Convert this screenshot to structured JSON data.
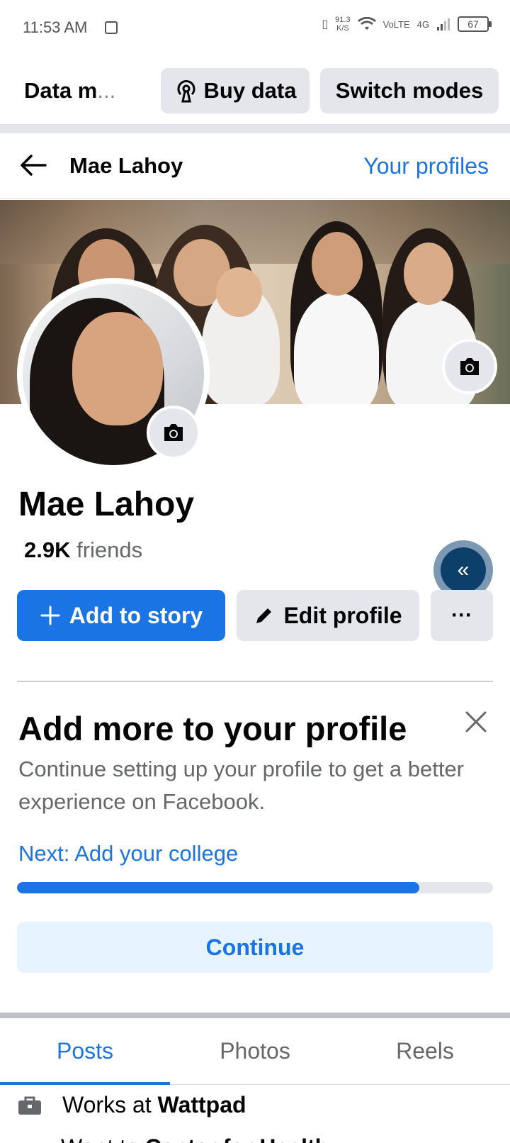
{
  "status": {
    "time": "11:53 AM",
    "speed_value": "91.3",
    "speed_unit": "K/S",
    "network": "4G",
    "battery": "67"
  },
  "data_bar": {
    "label": "Data m",
    "ellipsis": "...",
    "buy_label": "Buy data",
    "switch_label": "Switch modes"
  },
  "header": {
    "title": "Mae Lahoy",
    "link": "Your profiles"
  },
  "profile": {
    "name": "Mae Lahoy",
    "friends_count": "2.9K",
    "friends_label": "friends"
  },
  "actions": {
    "add_story": "Add to story",
    "edit_profile": "Edit profile",
    "more": "···"
  },
  "card": {
    "title": "Add more to your profile",
    "description": "Continue setting up your profile to get a better experience on Facebook.",
    "next": "Next: Add your college",
    "progress": 0.845,
    "continue_label": "Continue"
  },
  "tabs": [
    {
      "label": "Posts",
      "active": true
    },
    {
      "label": "Photos",
      "active": false
    },
    {
      "label": "Reels",
      "active": false
    }
  ],
  "details": {
    "works_prefix": "Works at",
    "works_place": "Wattpad",
    "went_prefix": "Went to",
    "went_place": "Center for Health"
  },
  "colors": {
    "accent": "#1b74e4",
    "button_gray": "#e4e6eb",
    "float_button": "#0d3f6b"
  }
}
